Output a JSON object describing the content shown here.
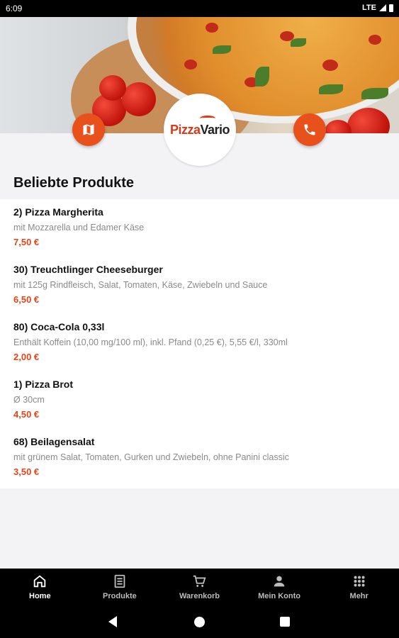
{
  "status_bar": {
    "time": "6:09",
    "network": "LTE"
  },
  "brand": {
    "logo_part1": "Pizza",
    "logo_part2": "Vario"
  },
  "hero": {
    "map_icon": "map-icon",
    "phone_icon": "phone-icon"
  },
  "section": {
    "title": "Beliebte Produkte"
  },
  "products": [
    {
      "name": "2) Pizza Margherita",
      "description": "mit Mozzarella und Edamer Käse",
      "price": "7,50 €"
    },
    {
      "name": "30) Treuchtlinger Cheeseburger",
      "description": "mit 125g Rindfleisch, Salat, Tomaten, Käse, Zwiebeln und Sauce",
      "price": "6,50 €"
    },
    {
      "name": "80) Coca-Cola 0,33l",
      "description": "Enthält Koffein (10,00 mg/100 ml), inkl. Pfand (0,25 €), 5,55 €/l, 330ml",
      "price": "2,00 €"
    },
    {
      "name": "1) Pizza Brot",
      "description": "Ø 30cm",
      "price": "4,50 €"
    },
    {
      "name": "68) Beilagensalat",
      "description": "mit grünem Salat, Tomaten, Gurken und Zwiebeln, ohne Panini classic",
      "price": "3,50 €"
    }
  ],
  "bottom_nav": [
    {
      "label": "Home",
      "icon": "home-icon",
      "active": true
    },
    {
      "label": "Produkte",
      "icon": "menu-book-icon",
      "active": false
    },
    {
      "label": "Warenkorb",
      "icon": "cart-icon",
      "active": false
    },
    {
      "label": "Mein Konto",
      "icon": "person-icon",
      "active": false
    },
    {
      "label": "Mehr",
      "icon": "apps-grid-icon",
      "active": false
    }
  ],
  "colors": {
    "accent": "#e8501c",
    "price": "#e64519",
    "nav_bg": "#000000"
  }
}
